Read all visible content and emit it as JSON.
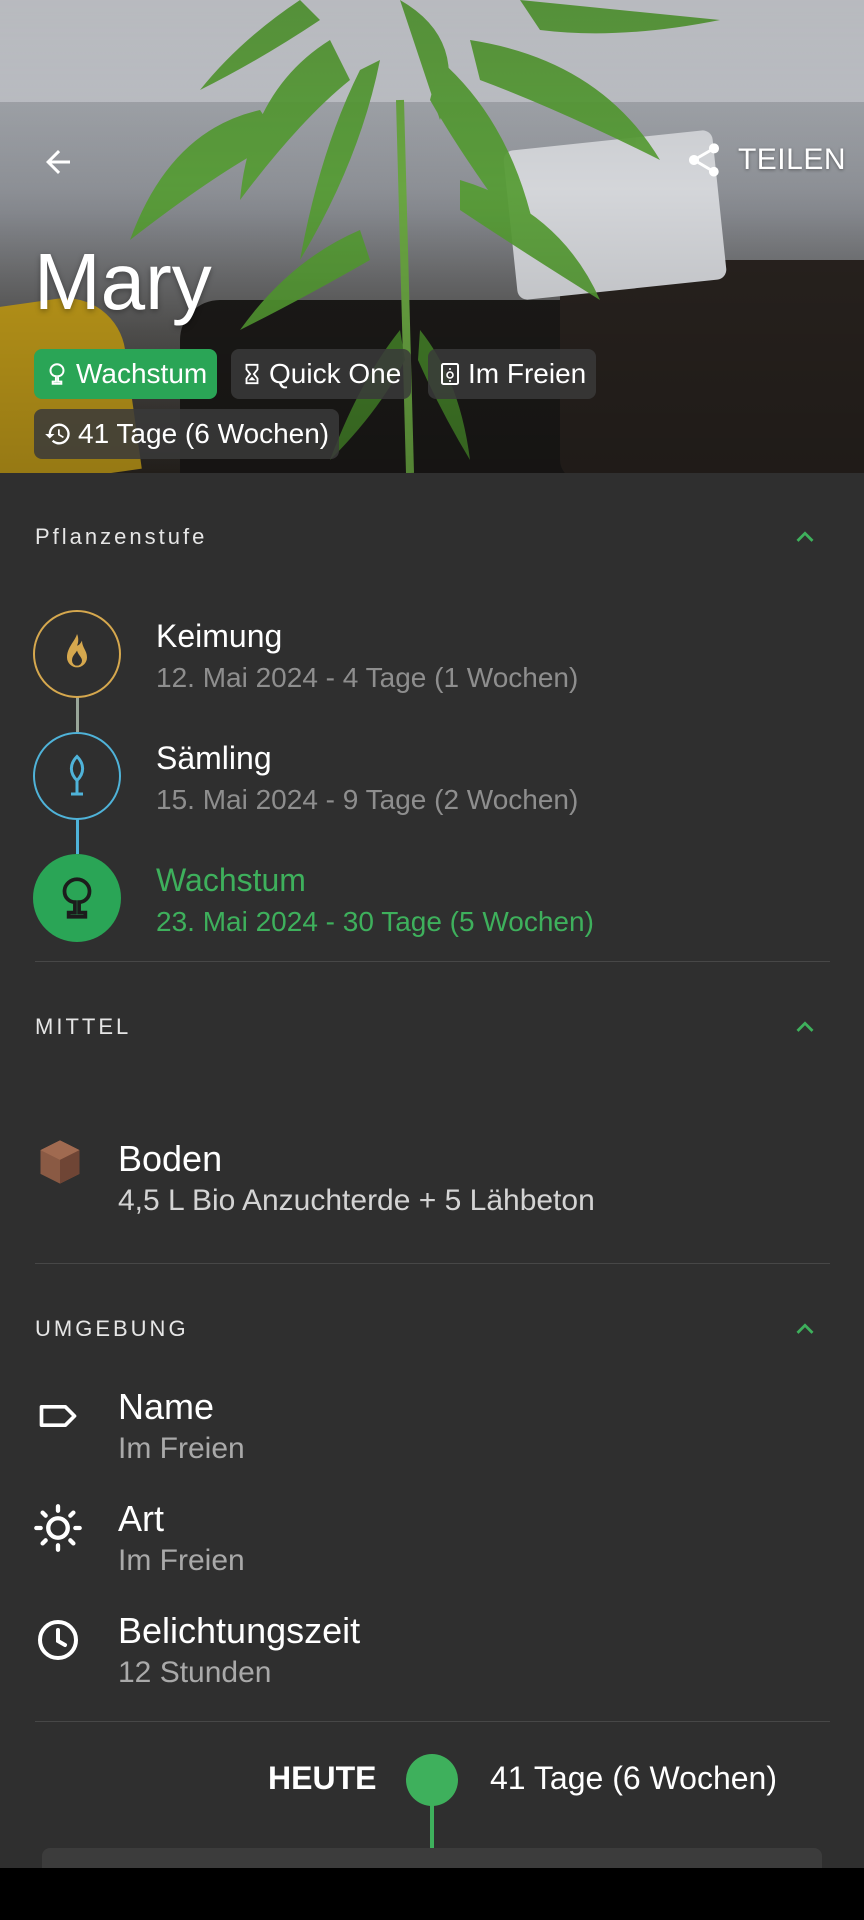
{
  "header": {
    "share_label": "TEILEN",
    "plant_name": "Mary",
    "chips": {
      "stage": "Wachstum",
      "strain": "Quick One",
      "environment": "Im Freien",
      "age": "41 Tage (6 Wochen)"
    }
  },
  "stages_section": {
    "title": "Pflanzenstufe",
    "stages": [
      {
        "name": "Keimung",
        "date": "12. Mai 2024 - 4 Tage (1 Wochen)"
      },
      {
        "name": "Sämling",
        "date": "15. Mai 2024 - 9 Tage (2 Wochen)"
      },
      {
        "name": "Wachstum",
        "date": "23. Mai 2024 - 30 Tage (5 Wochen)"
      }
    ]
  },
  "medium_section": {
    "title": "MITTEL",
    "medium_type": "Boden",
    "medium_desc": "4,5 L Bio Anzuchterde + 5 Lähbeton"
  },
  "environment_section": {
    "title": "UMGEBUNG",
    "items": [
      {
        "label": "Name",
        "value": "Im Freien"
      },
      {
        "label": "Art",
        "value": "Im Freien"
      },
      {
        "label": "Belichtungszeit",
        "value": "12 Stunden"
      }
    ]
  },
  "timeline": {
    "today_label": "HEUTE",
    "today_value": "41 Tage (6 Wochen)"
  },
  "colors": {
    "accent": "#3eb05c",
    "chip_green": "#2aa556",
    "background": "#2f2f2f",
    "germination": "#d6a84e",
    "seedling": "#4fb3d9"
  },
  "icons": [
    "back-arrow-icon",
    "share-icon",
    "tree-icon",
    "hourglass-icon",
    "outdoor-icon",
    "history-icon",
    "flame-seed-icon",
    "sprout-icon",
    "chevron-up-icon",
    "cube-icon",
    "tag-icon",
    "sun-icon",
    "clock-icon"
  ]
}
